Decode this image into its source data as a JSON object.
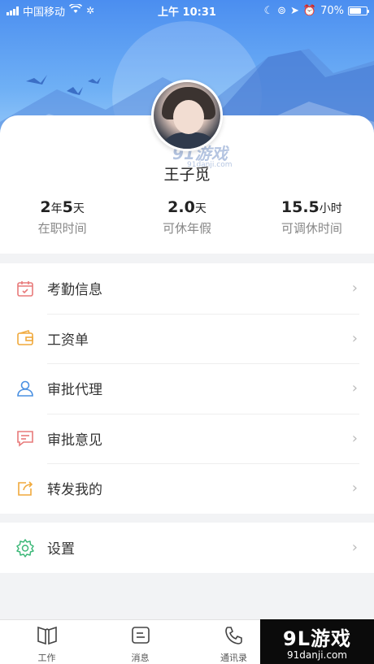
{
  "status_bar": {
    "carrier": "中国移动",
    "time": "上午 10:31",
    "battery": "70%",
    "battery_level": 0.7
  },
  "profile": {
    "name": "王子觅",
    "watermark": "91游戏",
    "watermark_url": "91danji.com"
  },
  "stats": [
    {
      "num1": "2",
      "unit1": "年",
      "num2": "5",
      "unit2": "天",
      "label": "在职时间"
    },
    {
      "num1": "2.0",
      "unit1": "天",
      "num2": "",
      "unit2": "",
      "label": "可休年假"
    },
    {
      "num1": "15.5",
      "unit1": "小时",
      "num2": "",
      "unit2": "",
      "label": "可调休时间"
    }
  ],
  "menu": [
    {
      "label": "考勤信息",
      "icon": "calendar-icon",
      "color": "#e87a7a"
    },
    {
      "label": "工资单",
      "icon": "wallet-icon",
      "color": "#f0a93c"
    },
    {
      "label": "审批代理",
      "icon": "user-icon",
      "color": "#4a90e2"
    },
    {
      "label": "审批意见",
      "icon": "comment-icon",
      "color": "#e87a7a"
    },
    {
      "label": "转发我的",
      "icon": "share-icon",
      "color": "#f0a93c"
    }
  ],
  "settings": {
    "label": "设置",
    "icon": "gear-icon",
    "color": "#3cb878"
  },
  "chevron": "›",
  "tabs": [
    {
      "label": "工作",
      "icon": "book-icon"
    },
    {
      "label": "消息",
      "icon": "message-icon"
    },
    {
      "label": "通讯录",
      "icon": "phone-icon"
    }
  ],
  "brand": {
    "name": "9L游戏",
    "url": "91danji.com"
  }
}
